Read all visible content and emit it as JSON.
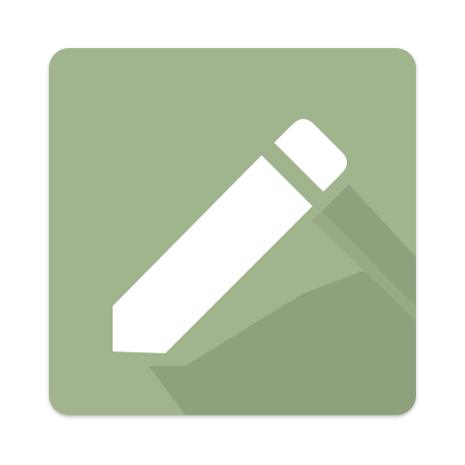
{
  "app_icon": {
    "name": "edit-pencil-icon",
    "background_color": "#a0b48d",
    "shadow_color": "#8ea07c",
    "glyph_color": "#ffffff"
  }
}
